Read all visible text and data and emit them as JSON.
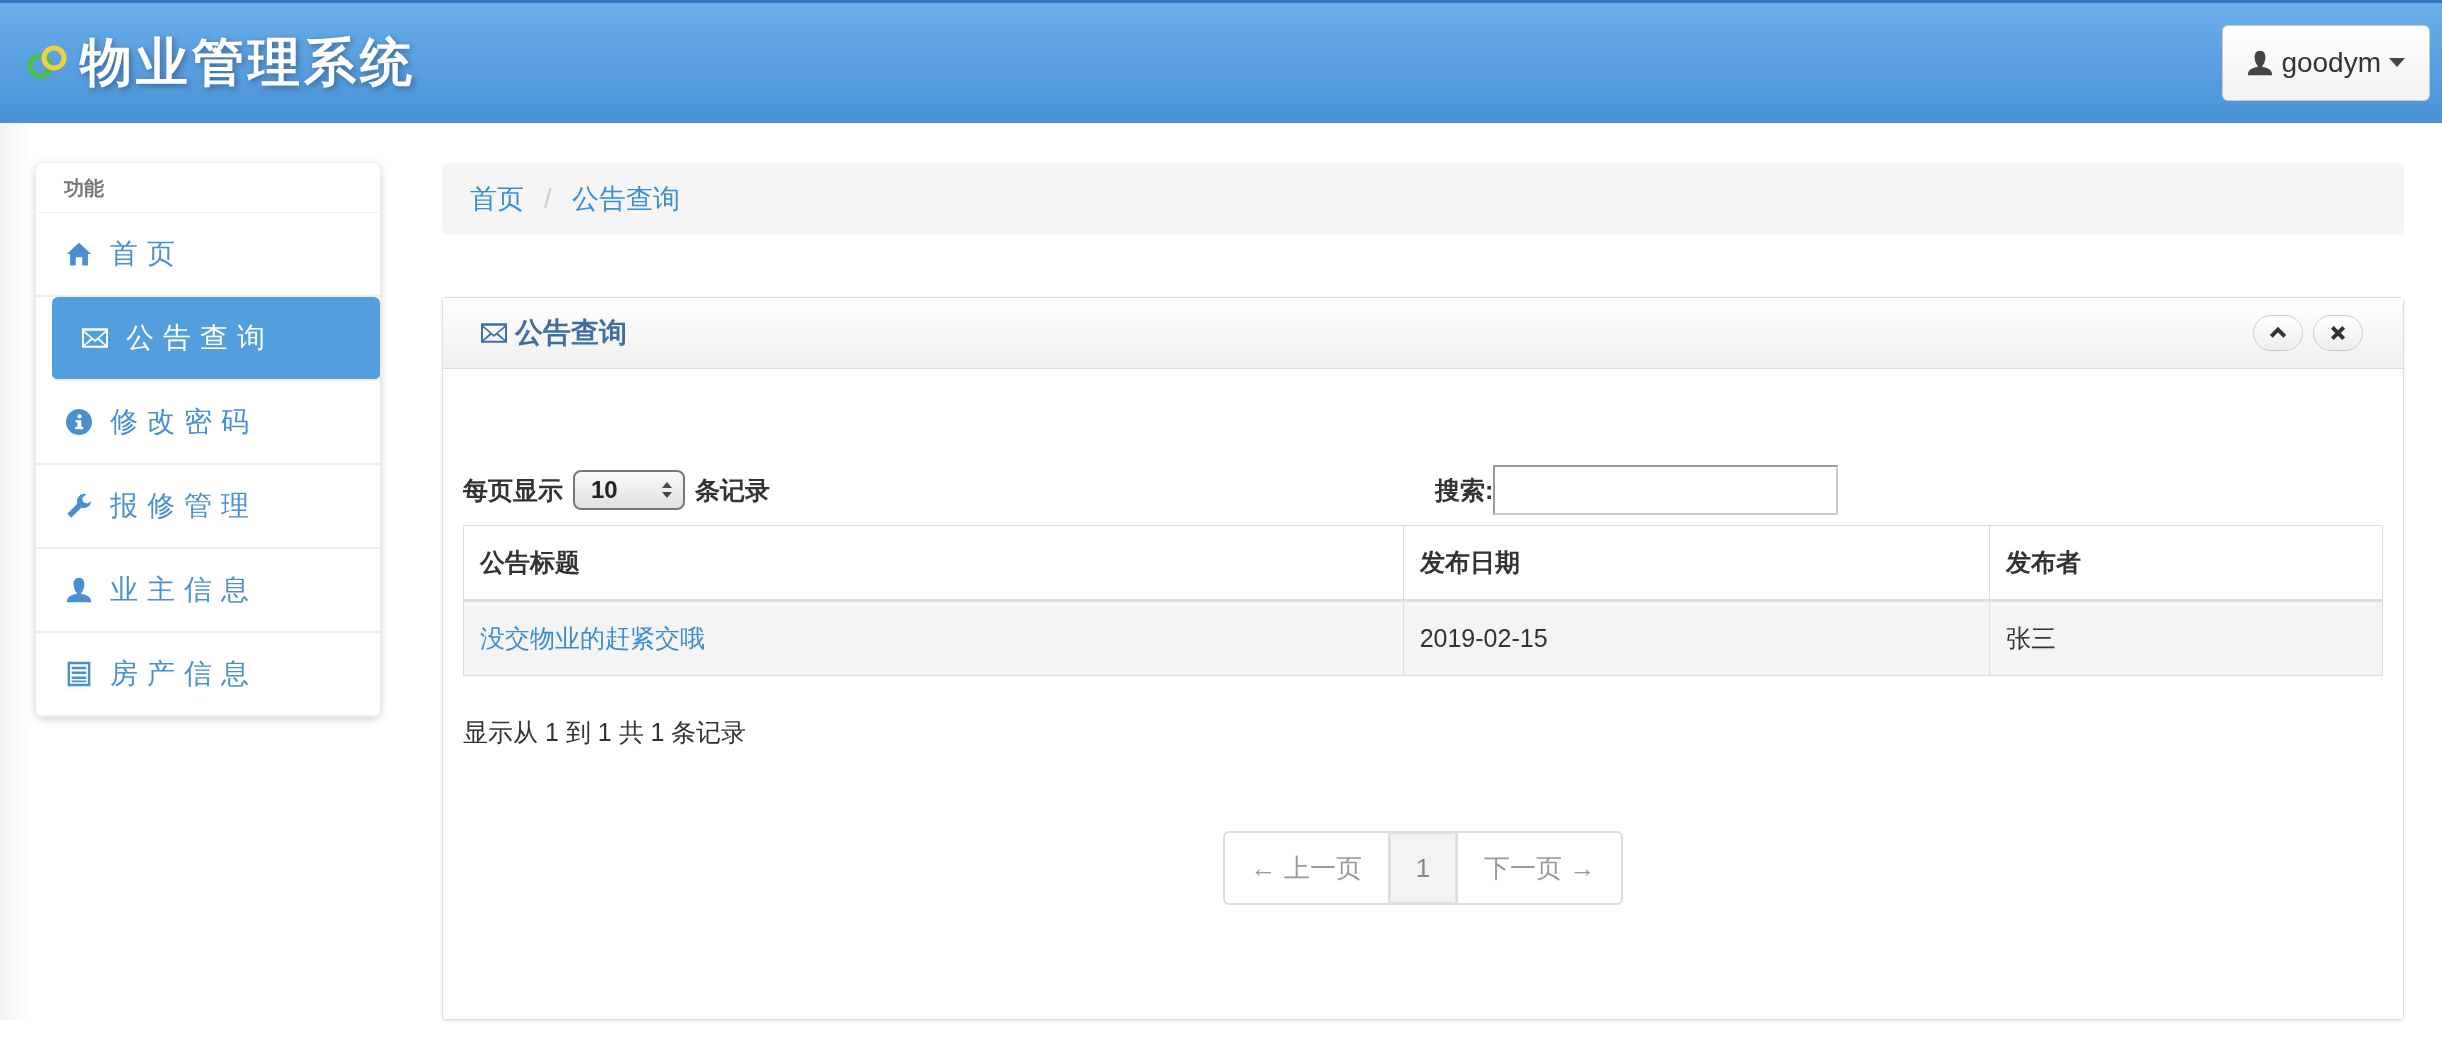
{
  "header": {
    "title": "物业管理系统",
    "user_menu": {
      "label": "goodym"
    }
  },
  "sidebar": {
    "heading": "功能",
    "items": [
      {
        "label": "首页",
        "kind": "home",
        "selected": false
      },
      {
        "label": "公告查询",
        "kind": "mail",
        "selected": true
      },
      {
        "label": "修改密码",
        "kind": "password",
        "selected": false
      },
      {
        "label": "报修管理",
        "kind": "repair",
        "selected": false
      },
      {
        "label": "业主信息",
        "kind": "owner",
        "selected": false
      },
      {
        "label": "房产信息",
        "kind": "property",
        "selected": false
      }
    ]
  },
  "breadcrumb": {
    "items": [
      "首页",
      "公告查询"
    ],
    "separator": "/"
  },
  "panel": {
    "title": "公告查询",
    "length_control": {
      "before": "每页显示",
      "value": "10",
      "after": "条记录"
    },
    "search": {
      "label": "搜索:"
    },
    "table": {
      "columns": [
        "公告标题",
        "发布日期",
        "发布者"
      ],
      "rows": [
        [
          "没交物业的赶紧交哦",
          "2019-02-15",
          "张三"
        ]
      ]
    },
    "info": "显示从 1 到 1 共 1 条记录",
    "pagination": [
      {
        "label": "← 上一页",
        "disabled": true,
        "selected": false
      },
      {
        "label": "1",
        "disabled": false,
        "selected": true
      },
      {
        "label": "下一页 →",
        "disabled": true,
        "selected": false
      }
    ]
  }
}
